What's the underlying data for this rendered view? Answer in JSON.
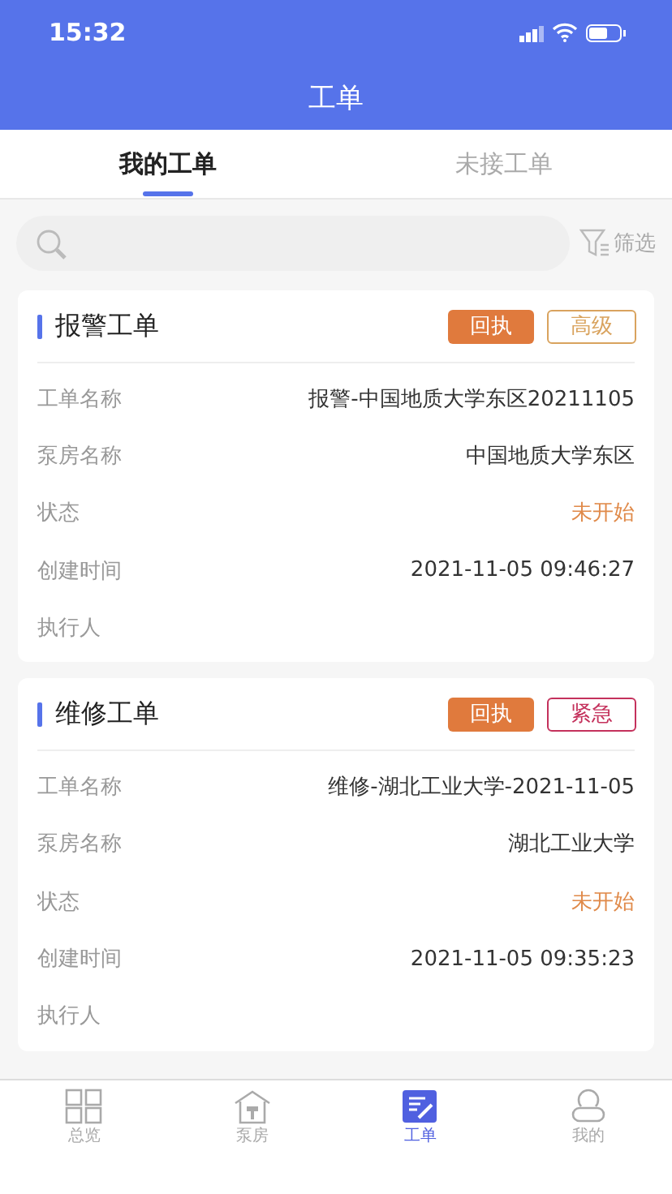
{
  "status_bar": {
    "time": "15:32"
  },
  "header": {
    "title": "工单"
  },
  "tabs": [
    {
      "label": "我的工单",
      "selected": true
    },
    {
      "label": "未接工单",
      "selected": false
    }
  ],
  "filter": {
    "label": "筛选"
  },
  "orders": [
    {
      "title": "报警工单",
      "action": "回执",
      "priority": {
        "label": "高级",
        "color": "#d9a35e"
      },
      "fields": [
        {
          "label": "工单名称",
          "value": "报警-中国地质大学东区20211105",
          "kind": "text"
        },
        {
          "label": "泵房名称",
          "value": "中国地质大学东区",
          "kind": "text"
        },
        {
          "label": "状态",
          "value": "未开始",
          "kind": "status"
        },
        {
          "label": "创建时间",
          "value": "2021-11-05 09:46:27",
          "kind": "text"
        },
        {
          "label": "执行人"
        }
      ]
    },
    {
      "title": "维修工单",
      "action": "回执",
      "priority": {
        "label": "紧急",
        "color": "#c4315c"
      },
      "fields": [
        {
          "label": "工单名称",
          "value": "维修-湖北工业大学-2021-11-05",
          "kind": "text"
        },
        {
          "label": "泵房名称",
          "value": "湖北工业大学",
          "kind": "text"
        },
        {
          "label": "状态",
          "value": "未开始",
          "kind": "status"
        },
        {
          "label": "创建时间",
          "value": "2021-11-05 09:35:23",
          "kind": "text"
        },
        {
          "label": "执行人"
        }
      ]
    }
  ],
  "nav": [
    {
      "label": "总览",
      "selected": false
    },
    {
      "label": "泵房",
      "selected": false
    },
    {
      "label": "工单",
      "selected": true
    },
    {
      "label": "我的",
      "selected": false
    }
  ]
}
